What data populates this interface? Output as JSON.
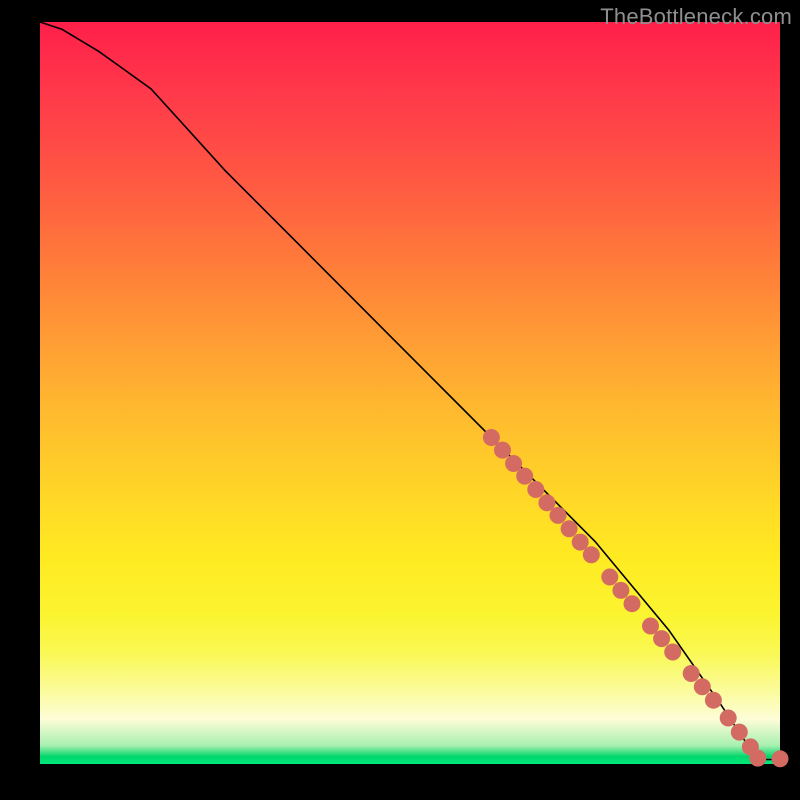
{
  "attribution": "TheBottleneck.com",
  "colors": {
    "dot": "#d46b63",
    "curve": "#000000"
  },
  "chart_data": {
    "type": "line",
    "title": "",
    "xlabel": "",
    "ylabel": "",
    "xlim": [
      0,
      100
    ],
    "ylim": [
      0,
      100
    ],
    "grid": false,
    "legend": false,
    "series": [
      {
        "name": "curve",
        "x": [
          0,
          3,
          8,
          15,
          25,
          35,
          45,
          55,
          65,
          75,
          85,
          92,
          96,
          98,
          100
        ],
        "values": [
          100,
          99,
          96,
          91,
          80,
          70,
          60,
          50,
          40,
          30,
          18,
          8,
          2,
          0.6,
          0.6
        ]
      }
    ],
    "points": [
      {
        "x": 61,
        "y": 44
      },
      {
        "x": 62.5,
        "y": 42.3
      },
      {
        "x": 64,
        "y": 40.5
      },
      {
        "x": 65.5,
        "y": 38.8
      },
      {
        "x": 67,
        "y": 37
      },
      {
        "x": 68.5,
        "y": 35.2
      },
      {
        "x": 70,
        "y": 33.5
      },
      {
        "x": 71.5,
        "y": 31.7
      },
      {
        "x": 73,
        "y": 29.9
      },
      {
        "x": 74.5,
        "y": 28.2
      },
      {
        "x": 77,
        "y": 25.2
      },
      {
        "x": 78.5,
        "y": 23.4
      },
      {
        "x": 80,
        "y": 21.6
      },
      {
        "x": 82.5,
        "y": 18.6
      },
      {
        "x": 84,
        "y": 16.9
      },
      {
        "x": 85.5,
        "y": 15.1
      },
      {
        "x": 88,
        "y": 12.2
      },
      {
        "x": 89.5,
        "y": 10.4
      },
      {
        "x": 91,
        "y": 8.6
      },
      {
        "x": 93,
        "y": 6.2
      },
      {
        "x": 94.5,
        "y": 4.3
      },
      {
        "x": 96,
        "y": 2.3
      },
      {
        "x": 97,
        "y": 0.8
      },
      {
        "x": 100,
        "y": 0.7
      }
    ]
  }
}
